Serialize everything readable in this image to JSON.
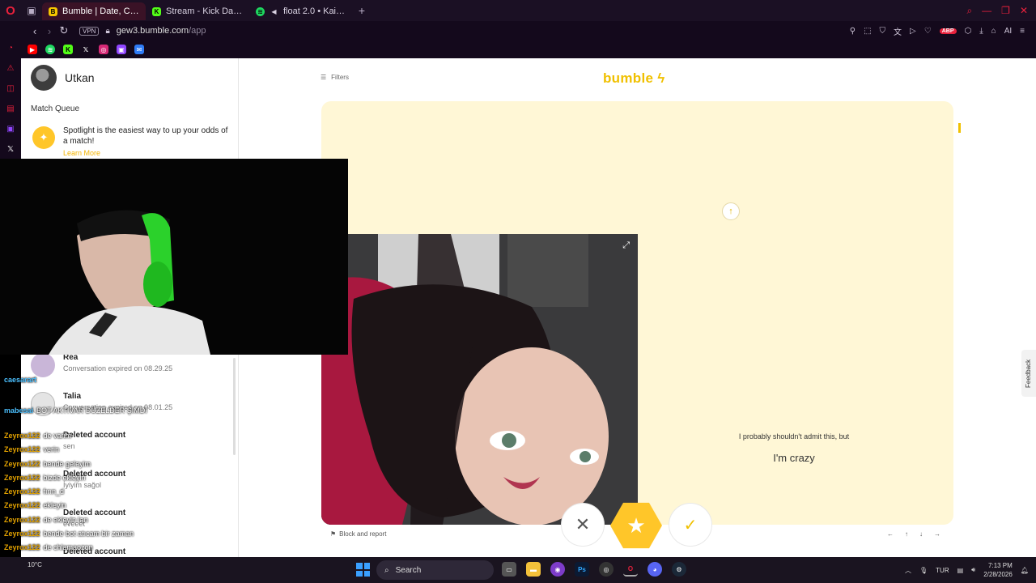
{
  "browser": {
    "tabs": [
      {
        "title": "Bumble | Date, Chat, Meet New People & Network Better",
        "color": "#f7c600",
        "active": true
      },
      {
        "title": "Stream - Kick Dashboard",
        "color": "#53fc18",
        "active": false
      },
      {
        "title": "float 2.0 • Kairo Keyz",
        "color": "#1ed760",
        "active": false
      }
    ],
    "tab_add": "+",
    "vpn": "VPN",
    "url_host": "gew3.bumble.com",
    "url_path": "/app",
    "ai_label": "AI",
    "adblock_badge": "ABP"
  },
  "bumble": {
    "user_name": "Utkan",
    "match_queue_label": "Match Queue",
    "spotlight_text": "Spotlight is the easiest way to up your odds of a match!",
    "learn_more": "Learn More",
    "conversations": [
      {
        "name": "Rea",
        "sub": "Conversation expired on 08.29.25"
      },
      {
        "name": "Talia",
        "sub": "Conversation expired on 08.01.25"
      },
      {
        "name": "Deleted account",
        "sub": "sen"
      },
      {
        "name": "Deleted account",
        "sub": "İyiyim sağol"
      },
      {
        "name": "Deleted account",
        "sub": "eveeet"
      },
      {
        "name": "Deleted account",
        "sub": ""
      }
    ],
    "filters_label": "Filters",
    "logo_text": "bumble",
    "prompt_question": "I probably shouldn't admit this, but",
    "prompt_answer": "I'm crazy",
    "block_report": "Block and report",
    "kbd_hints": [
      "←",
      "↑",
      "↓",
      "→"
    ],
    "feedback": "Feedback",
    "brand_color": "#ffc629"
  },
  "chat": [
    {
      "user": "caesarart",
      "msg": ""
    },
    {
      "user": "mabesai",
      "msg": "BOT AKTİVAR DÜZELDER ŞİMDİ"
    },
    {
      "user": "Zeyrox122",
      "msg": "de varim"
    },
    {
      "user": "Zeyrox122",
      "msg": "verin"
    },
    {
      "user": "Zeyrox122",
      "msg": "bende geleyim"
    },
    {
      "user": "Zeyrox122",
      "msg": "bizde ekleyin"
    },
    {
      "user": "Zeyrox122",
      "msg": "fırın_d"
    },
    {
      "user": "Zeyrox122",
      "msg": "ekleyin"
    },
    {
      "user": "Zeyrox122",
      "msg": "de ekleyin lan"
    },
    {
      "user": "Zeyrox122",
      "msg": "bende bot atıcam bir zaman"
    },
    {
      "user": "Zeyrox122",
      "msg": "de chlamaozon"
    },
    {
      "user": "Zeyrox122",
      "msg": "kuserim"
    },
    {
      "user": "Zeyrox122",
      "msg": "ee bunlar yazmıyomu"
    }
  ],
  "taskbar": {
    "search_label": "Search",
    "weather": "10°C",
    "lang": "TUR",
    "time": "7:13 PM",
    "date": "2/28/2026"
  }
}
